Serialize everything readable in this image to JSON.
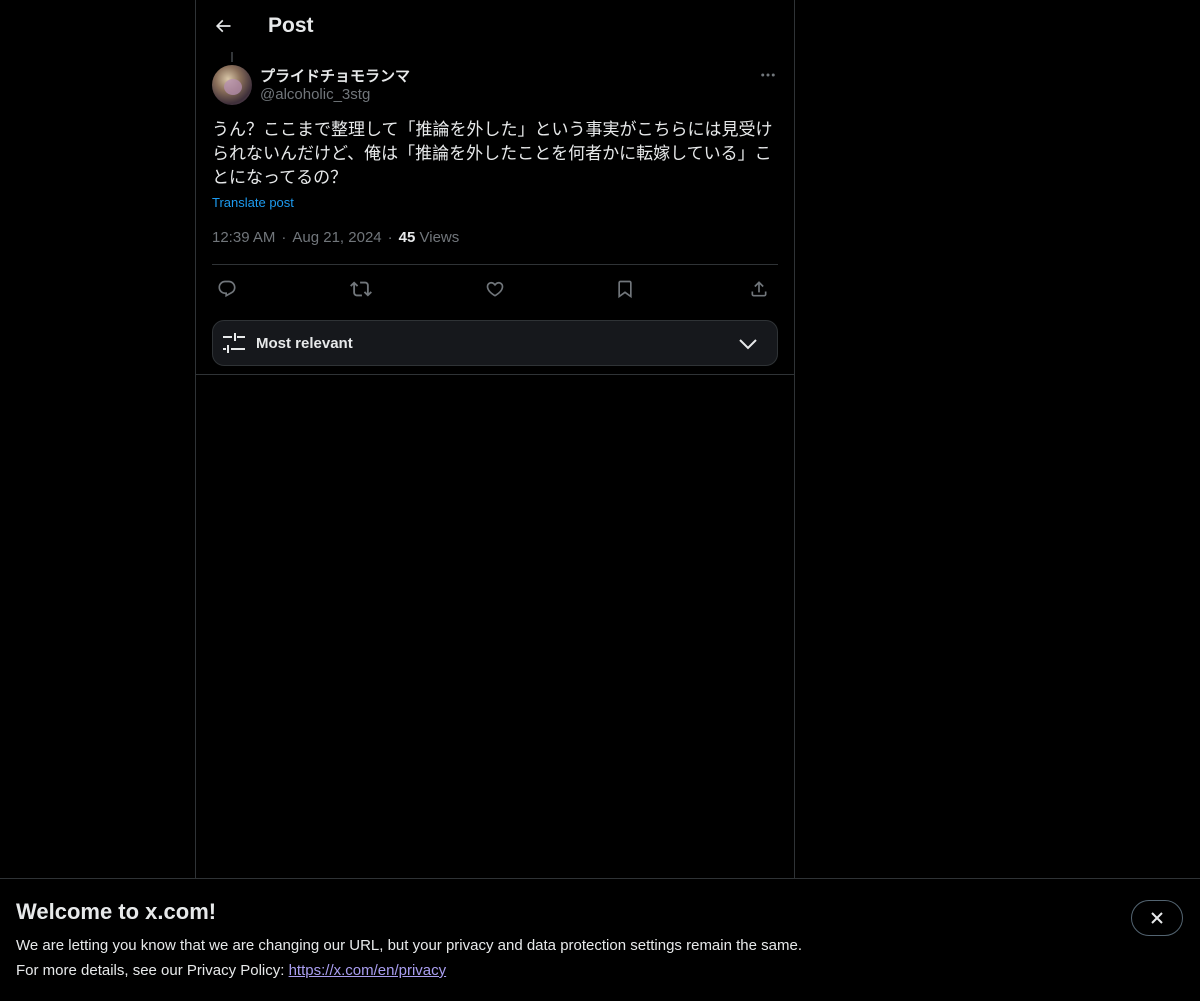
{
  "header": {
    "title": "Post",
    "back_icon": "arrow-left-icon"
  },
  "post": {
    "author": {
      "display_name": "プライドチョモランマ",
      "handle": "@alcoholic_3stg"
    },
    "text": "うん？ここまで整理して「推論を外した」という事実がこちらには見受けられないんだけど、俺は「推論を外したことを何者かに転嫁している」ことになってるの？",
    "translate_label": "Translate post",
    "time": "12:39 AM",
    "date": "Aug 21, 2024",
    "separator": "·",
    "views_count": "45",
    "views_label": "Views"
  },
  "actions": [
    {
      "name": "reply",
      "icon": "reply-icon"
    },
    {
      "name": "repost",
      "icon": "repost-icon"
    },
    {
      "name": "like",
      "icon": "heart-icon"
    },
    {
      "name": "bookmark",
      "icon": "bookmark-icon"
    },
    {
      "name": "share",
      "icon": "share-icon"
    }
  ],
  "replies_sort": {
    "selected": "Most relevant"
  },
  "banner": {
    "title": "Welcome to x.com!",
    "line1": "We are letting you know that we are changing our URL, but your privacy and data protection settings remain the same.",
    "line2_prefix": "For more details, see our Privacy Policy: ",
    "link_text": "https://x.com/en/privacy"
  },
  "colors": {
    "background": "#000000",
    "text_primary": "#e7e9ea",
    "text_secondary": "#71767b",
    "accent": "#1d9bf0",
    "border": "#2f3336",
    "link": "#a99ef0"
  }
}
